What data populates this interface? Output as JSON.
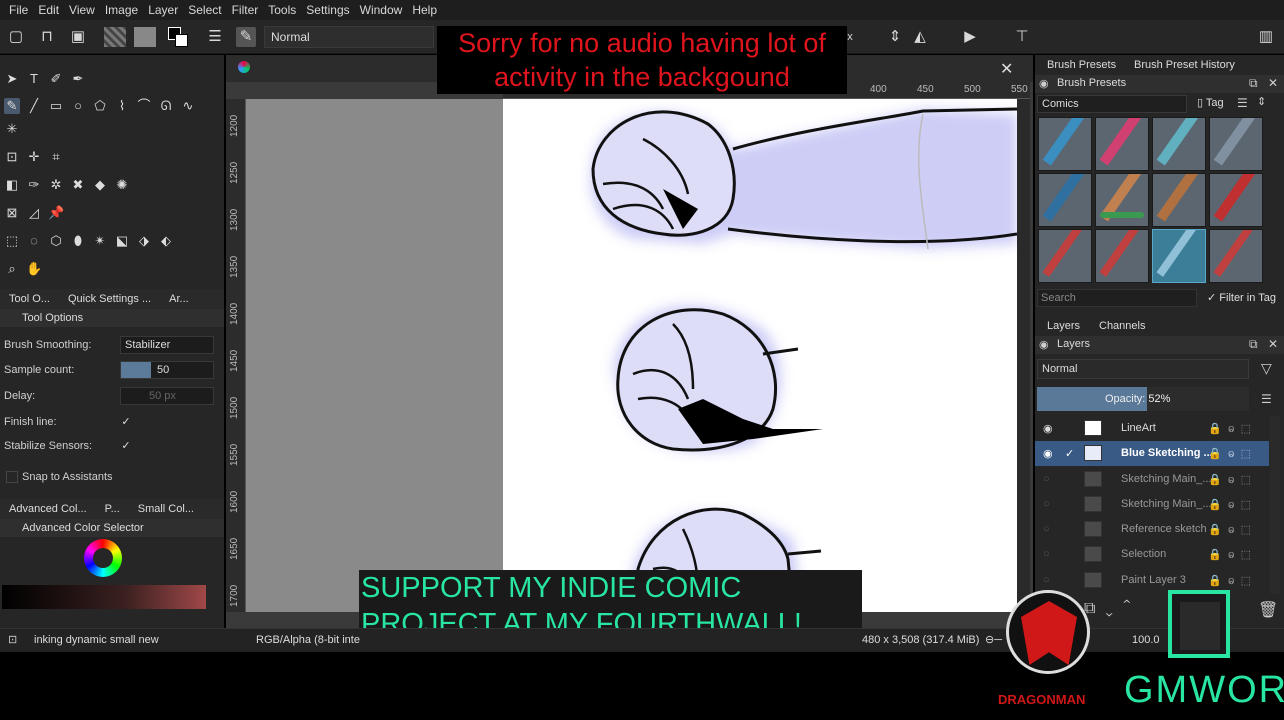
{
  "menu": [
    "File",
    "Edit",
    "View",
    "Image",
    "Layer",
    "Select",
    "Filter",
    "Tools",
    "Settings",
    "Window",
    "Help"
  ],
  "toolbar": {
    "blend_mode": "Normal",
    "x_suffix": "x"
  },
  "overlay_top": {
    "line1": "Sorry for no audio having lot of",
    "line2": "activity in the backgound"
  },
  "overlay_bottom": {
    "line1": "SUPPORT MY INDIE COMIC",
    "line2": "PROJECT AT MY FOURTHWALL!"
  },
  "left_tabs": [
    "Tool O...",
    "Quick Settings ...",
    "Ar..."
  ],
  "tool_options": {
    "title": "Tool Options",
    "brush_smoothing_label": "Brush Smoothing:",
    "brush_smoothing_value": "Stabilizer",
    "sample_count_label": "Sample count:",
    "sample_count_value": "50",
    "delay_label": "Delay:",
    "delay_value": "50 px",
    "finish_line_label": "Finish line:",
    "stabilize_label": "Stabilize Sensors:",
    "snap_label": "Snap to Assistants"
  },
  "color_tabs": [
    "Advanced Col...",
    "P...",
    "Small Col..."
  ],
  "color_selector_title": "Advanced Color Selector",
  "ruler_h": [
    "400",
    "450",
    "500",
    "550"
  ],
  "ruler_v": [
    "1200",
    "1250",
    "1300",
    "1350",
    "1400",
    "1450",
    "1500",
    "1550",
    "1600",
    "1650",
    "1700"
  ],
  "right_top_tabs": [
    "Brush Presets",
    "Brush Preset History"
  ],
  "brush_presets": {
    "title": "Brush Presets",
    "tag": "Comics",
    "tag_btn": "Tag",
    "search_placeholder": "Search",
    "filter_label": "Filter in Tag"
  },
  "layer_tabs": [
    "Layers",
    "Channels"
  ],
  "layers_panel": {
    "title": "Layers",
    "blend": "Normal",
    "opacity_label": "Opacity:",
    "opacity_value": "52%"
  },
  "layers": [
    {
      "name": "LineArt",
      "visible": true,
      "selected": false
    },
    {
      "name": "Blue Sketching ...",
      "visible": true,
      "selected": true
    },
    {
      "name": "Sketching Main_...",
      "visible": false,
      "selected": false
    },
    {
      "name": "Sketching Main_...",
      "visible": false,
      "selected": false
    },
    {
      "name": "Reference sketch",
      "visible": false,
      "selected": false
    },
    {
      "name": "Selection",
      "visible": false,
      "selected": false
    },
    {
      "name": "Paint Layer 3",
      "visible": false,
      "selected": false
    }
  ],
  "status": {
    "brush": "inking dynamic small new",
    "color_mode": "RGB/Alpha (8-bit inte",
    "size": "480 x 3,508 (317.4 MiB)",
    "zoom": "100.0"
  },
  "logos": {
    "dragonman": "DRAGONMAN",
    "gmwor": "GMWOR"
  },
  "colors": {
    "panel": "#262626",
    "selection": "#3a5a86",
    "overlay_red": "#e0141c",
    "overlay_green": "#28e6a2"
  }
}
